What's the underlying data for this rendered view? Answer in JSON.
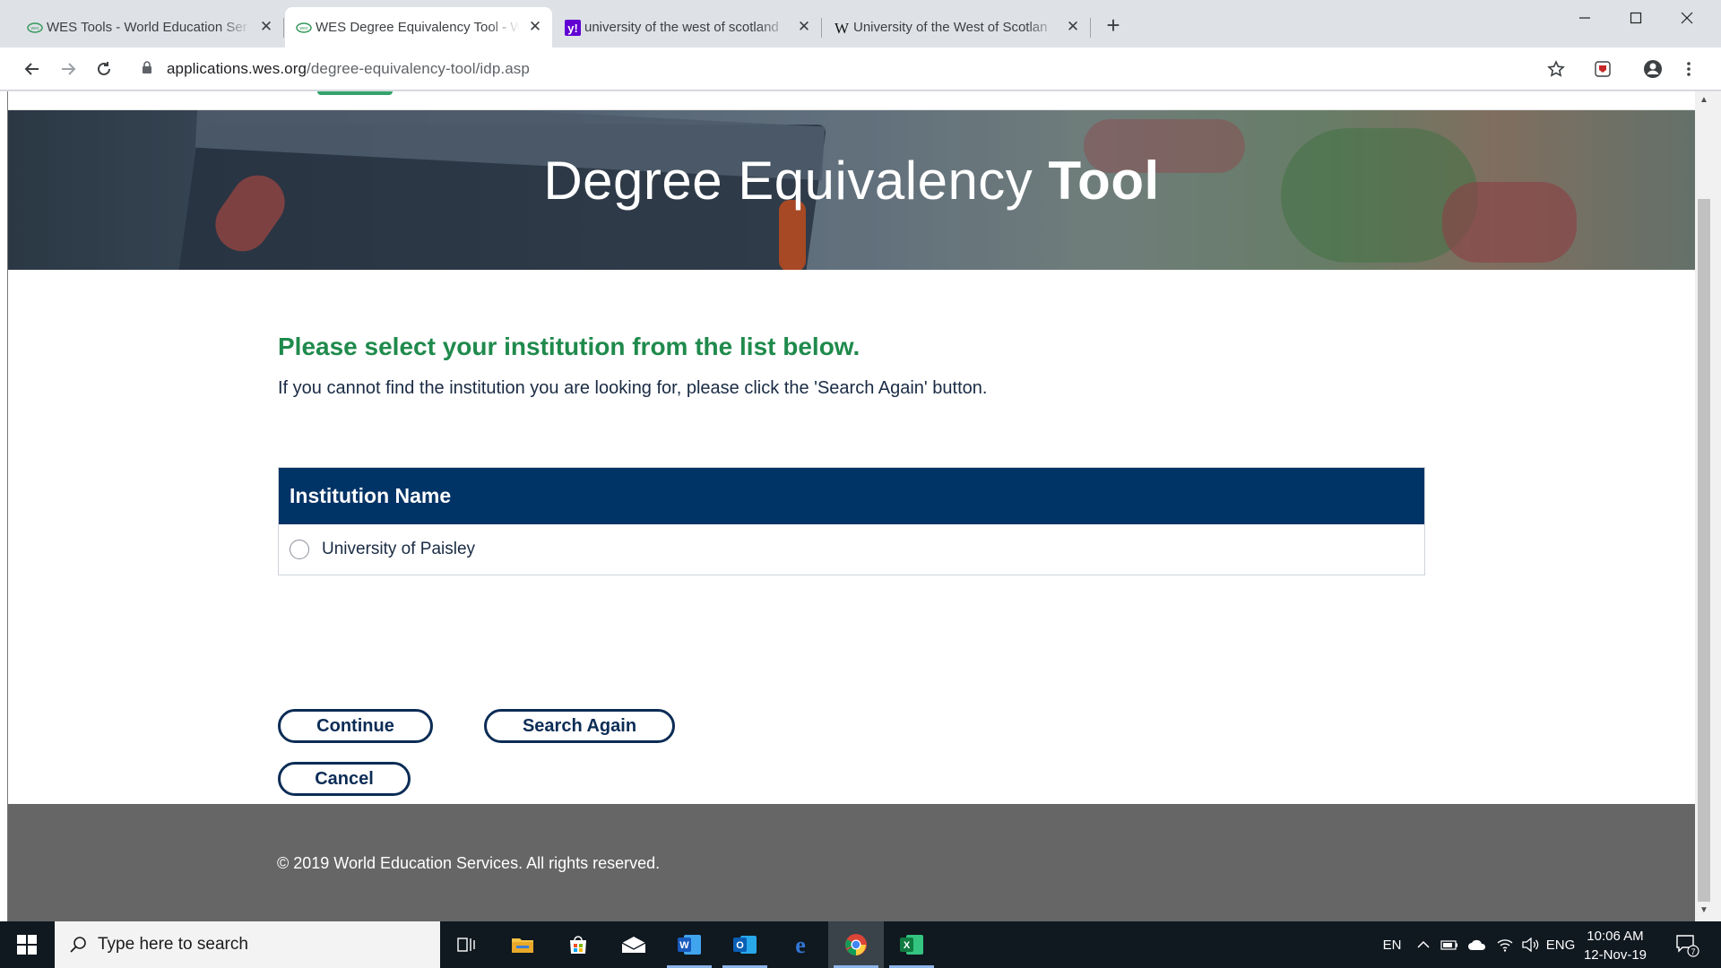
{
  "browser": {
    "tabs": [
      {
        "title": "WES Tools - World Education Ser",
        "favicon": "wes-logo-icon",
        "active": false
      },
      {
        "title": "WES Degree Equivalency Tool - W",
        "favicon": "wes-logo-icon",
        "active": true
      },
      {
        "title": "university of the west of scotland",
        "favicon": "yahoo-icon",
        "active": false
      },
      {
        "title": "University of the West of Scotlan",
        "favicon": "wikipedia-icon",
        "active": false
      }
    ],
    "address": {
      "host": "applications.wes.org",
      "path": "/degree-equivalency-tool/idp.asp"
    }
  },
  "page": {
    "hero_title_light": "Degree Equivalency ",
    "hero_title_bold": "Tool",
    "heading": "Please select your institution from the list below.",
    "subtext": "If you cannot find the institution you are looking for, please click the 'Search Again' button.",
    "table": {
      "header": "Institution Name",
      "rows": [
        {
          "label": "University of Paisley",
          "selected": false
        }
      ]
    },
    "buttons": {
      "continue": "Continue",
      "search_again": "Search Again",
      "cancel": "Cancel"
    },
    "footer": "© 2019 World Education Services. All rights reserved."
  },
  "colors": {
    "heading_green": "#1f8a4c",
    "table_header_navy": "#003366",
    "button_navy": "#0b2c55",
    "footer_gray": "#666666"
  },
  "taskbar": {
    "search_placeholder": "Type here to search",
    "apps": [
      "task-view-icon",
      "file-explorer-icon",
      "store-icon",
      "mail-icon",
      "word-icon",
      "outlook-icon",
      "edge-icon",
      "chrome-icon",
      "excel-icon"
    ],
    "tray": {
      "lang1": "EN",
      "lang2": "ENG",
      "time": "10:06 AM",
      "date": "12-Nov-19",
      "notifications": "7"
    }
  }
}
